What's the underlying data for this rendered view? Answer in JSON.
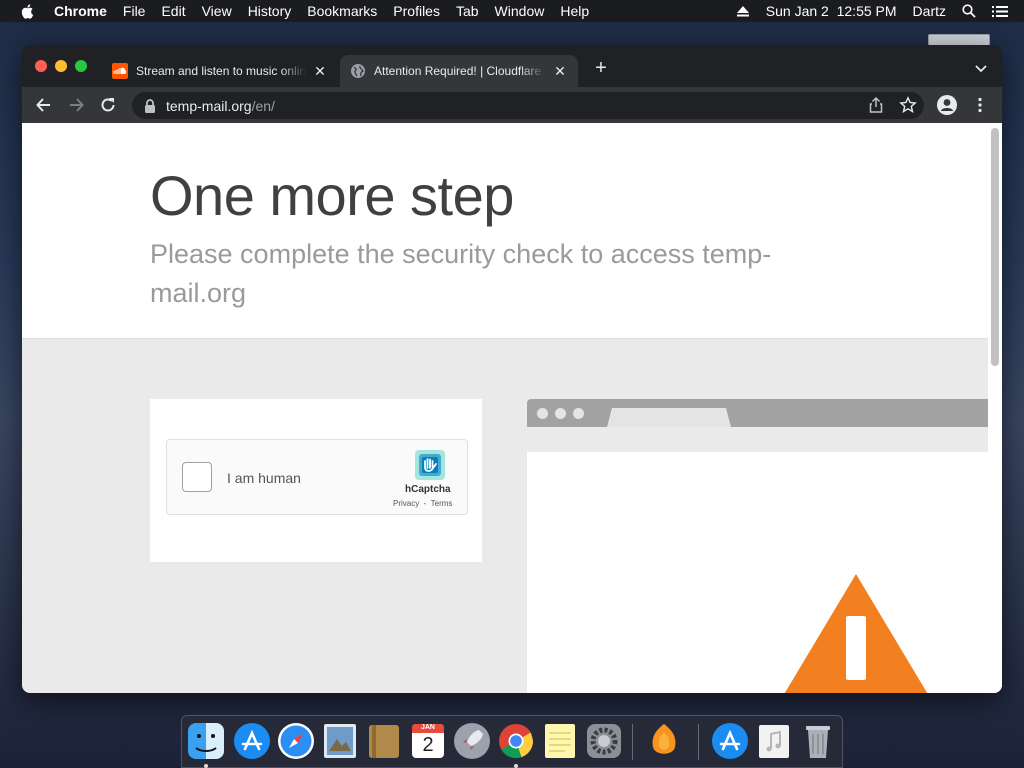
{
  "menubar": {
    "app_name": "Chrome",
    "menus": [
      "File",
      "Edit",
      "View",
      "History",
      "Bookmarks",
      "Profiles",
      "Tab",
      "Window",
      "Help"
    ],
    "datetime": "Sun Jan 2  12:55 PM",
    "user": "Dartz"
  },
  "tabs": [
    {
      "title": "Stream and listen to music online",
      "favicon": "soundcloud-icon",
      "active": false
    },
    {
      "title": "Attention Required! | Cloudflare",
      "favicon": "globe-icon",
      "active": true
    }
  ],
  "omnibox": {
    "host": "temp-mail.org",
    "path": "/en/"
  },
  "page": {
    "title": "One more step",
    "subtitle": "Please complete the security check to access temp-mail.org"
  },
  "captcha": {
    "label": "I am human",
    "brand": "hCaptcha",
    "links": "Privacy  -  Terms"
  },
  "dock": {
    "apps": [
      "finder-icon",
      "app-store-icon",
      "safari-icon",
      "preview-icon",
      "notefile-icon",
      "calendar-icon",
      "launchpad-icon",
      "chrome-icon",
      "notes-icon",
      "system-preferences-icon",
      "fl-studio-icon",
      "app-store-icon",
      "music-file-icon",
      "trash-icon"
    ],
    "calendar": {
      "month": "JAN",
      "day": "2"
    }
  },
  "colors": {
    "menubar_bg": "#1b1c20",
    "chrome_frame": "#202124",
    "chrome_toolbar": "#35363a",
    "page_bg": "#eaeaea",
    "title_text": "#404040",
    "subtitle_text": "#9a9a9a",
    "warning_orange": "#f38020",
    "hcaptcha_teal": "#0074bf"
  }
}
